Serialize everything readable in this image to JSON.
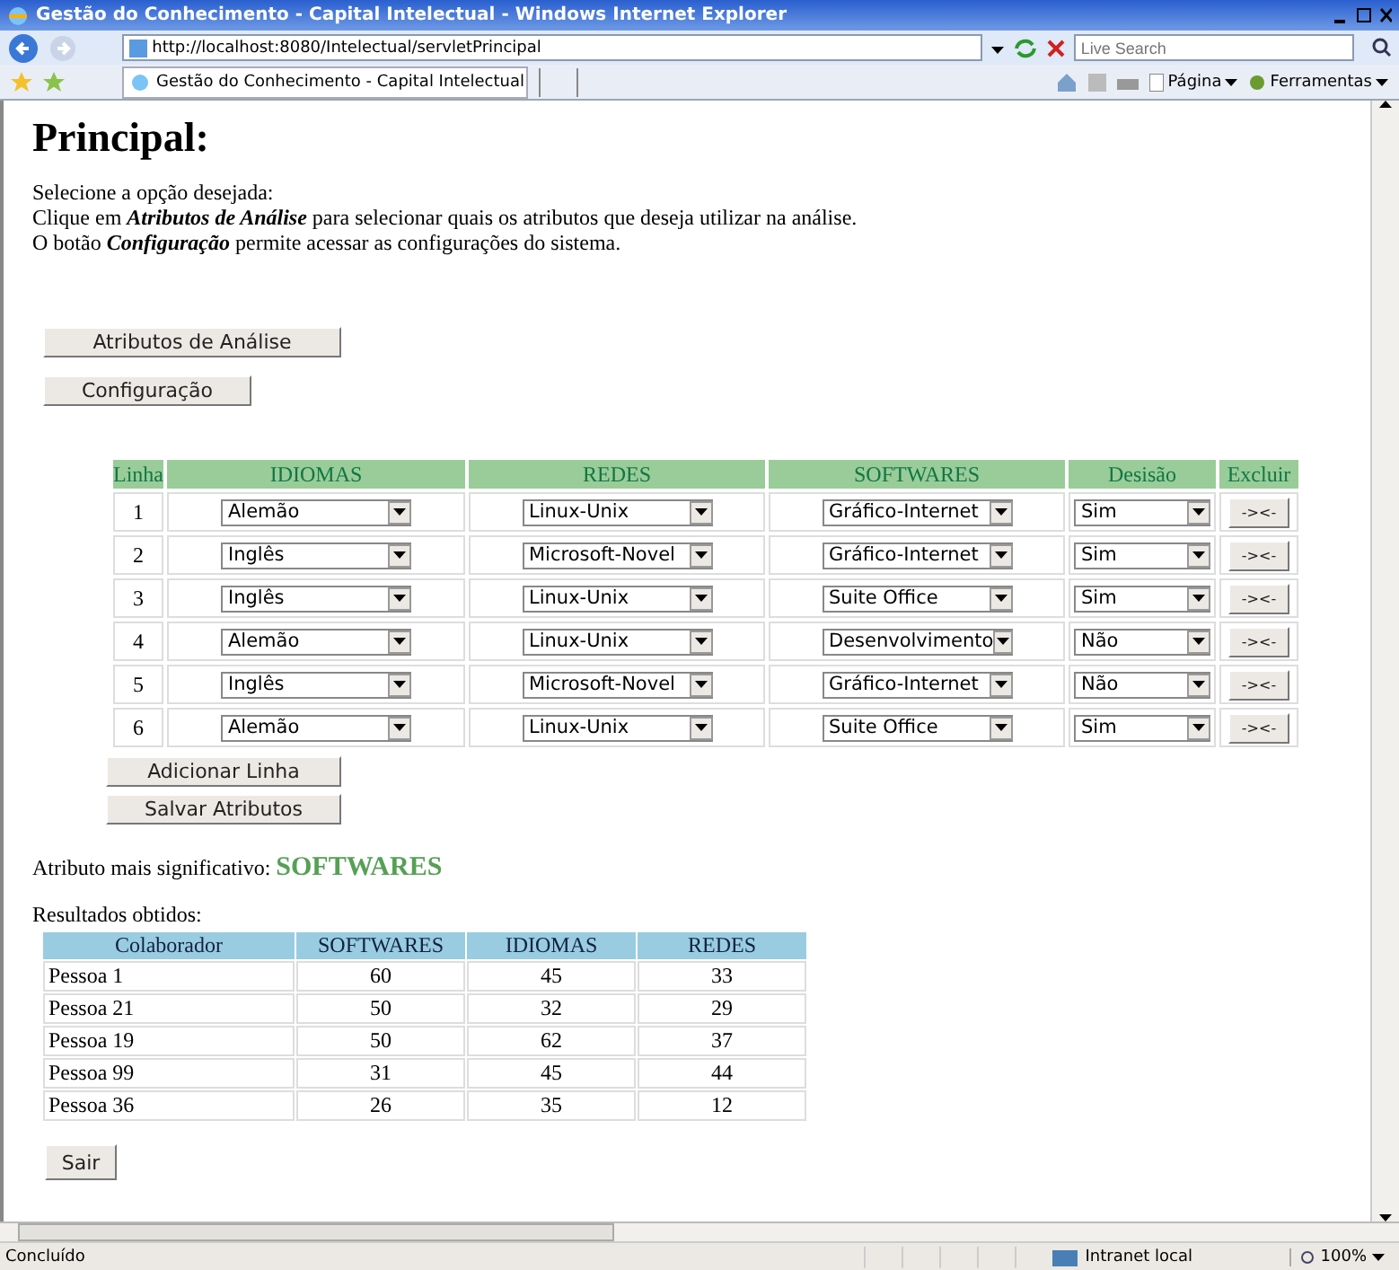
{
  "window": {
    "title": "Gestão do Conhecimento - Capital Intelectual - Windows Internet Explorer"
  },
  "address_bar": {
    "url": "http://localhost:8080/Intelectual/servletPrincipal"
  },
  "search": {
    "placeholder": "Live Search"
  },
  "tabs": [
    {
      "label": "Gestão do Conhecimento - Capital Intelectual",
      "selected": true
    }
  ],
  "toolbar": {
    "page_menu": "Página",
    "tools_menu": "Ferramentas"
  },
  "page": {
    "heading": "Principal:",
    "instructions": [
      "Selecione a opção desejada:",
      "Clique em **Atributos de Análise** para selecionar quais os atributos que deseja utilizar na análise.",
      "O botão **Configuração** permite acessar as configurações do sistema."
    ],
    "buttons": [
      "Atributos de Análise",
      "Configuração"
    ],
    "attributes_table": {
      "columns": [
        "Linha",
        "IDIOMAS",
        "REDES",
        "SOFTWARES",
        "Desisão",
        "Excluir"
      ],
      "rows": [
        {
          "line": "1",
          "idiomas": "Alemão",
          "redes": "Linux-Unix",
          "softwares": "Gráfico-Internet",
          "decision": "Sim",
          "delete": "-><-"
        },
        {
          "line": "2",
          "idiomas": "Inglês",
          "redes": "Microsoft-Novel",
          "softwares": "Gráfico-Internet",
          "decision": "Sim",
          "delete": "-><-"
        },
        {
          "line": "3",
          "idiomas": "Inglês",
          "redes": "Linux-Unix",
          "softwares": "Suite Office",
          "decision": "Sim",
          "delete": "-><-"
        },
        {
          "line": "4",
          "idiomas": "Alemão",
          "redes": "Linux-Unix",
          "softwares": "Desenvolvimento",
          "decision": "Não",
          "delete": "-><-"
        },
        {
          "line": "5",
          "idiomas": "Inglês",
          "redes": "Microsoft-Novel",
          "softwares": "Gráfico-Internet",
          "decision": "Não",
          "delete": "-><-"
        },
        {
          "line": "6",
          "idiomas": "Alemão",
          "redes": "Linux-Unix",
          "softwares": "Suite Office",
          "decision": "Sim",
          "delete": "-><-"
        }
      ]
    },
    "table_buttons": [
      "Adicionar Linha",
      "Salvar Atributos"
    ],
    "result": {
      "label": "Atributo mais significativo:",
      "value": "SOFTWARES"
    },
    "results": {
      "caption": "Resultados obtidos:",
      "columns": [
        "Colaborador",
        "SOFTWARES",
        "IDIOMAS",
        "REDES"
      ],
      "rows": [
        [
          "Pessoa 1",
          "60",
          "45",
          "33"
        ],
        [
          "Pessoa 21",
          "50",
          "32",
          "29"
        ],
        [
          "Pessoa 19",
          "50",
          "62",
          "37"
        ],
        [
          "Pessoa 99",
          "31",
          "45",
          "44"
        ],
        [
          "Pessoa 36",
          "26",
          "35",
          "12"
        ]
      ]
    },
    "exit_button": "Sair"
  },
  "status_bar": {
    "text": "Concluído",
    "zone": "Intranet local",
    "zoom": "100%"
  }
}
